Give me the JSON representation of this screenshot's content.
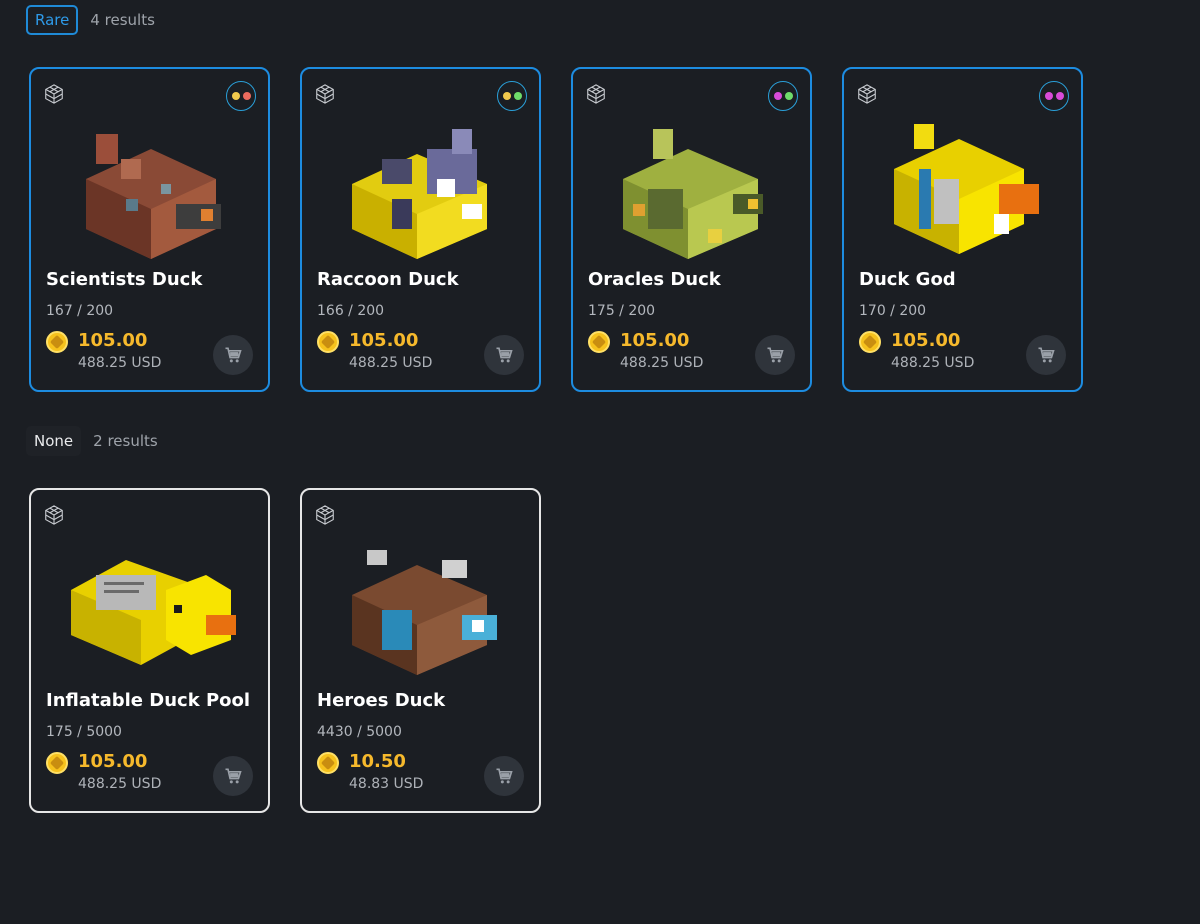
{
  "sections": [
    {
      "chip": "Rare",
      "results": "4 results",
      "cards": [
        {
          "name": "Scientists Duck",
          "supply": "167 / 200",
          "price": "105.00",
          "usd": "488.25 USD",
          "dot_colors": [
            "#f2c94c",
            "#eb6b5e"
          ]
        },
        {
          "name": "Raccoon Duck",
          "supply": "166 / 200",
          "price": "105.00",
          "usd": "488.25 USD",
          "dot_colors": [
            "#f2c94c",
            "#6fdc6a"
          ]
        },
        {
          "name": "Oracles Duck",
          "supply": "175 / 200",
          "price": "105.00",
          "usd": "488.25 USD",
          "dot_colors": [
            "#d94bd9",
            "#6fdc6a"
          ]
        },
        {
          "name": "Duck God",
          "supply": "170 / 200",
          "price": "105.00",
          "usd": "488.25 USD",
          "dot_colors": [
            "#d94bd9",
            "#d94bd9"
          ]
        }
      ]
    },
    {
      "chip": "None",
      "results": "2 results",
      "cards": [
        {
          "name": "Inflatable Duck Pool",
          "supply": "175 / 5000",
          "price": "105.00",
          "usd": "488.25 USD"
        },
        {
          "name": "Heroes Duck",
          "supply": "4430 / 5000",
          "price": "10.50",
          "usd": "48.83 USD"
        }
      ]
    }
  ],
  "icons": {
    "model": "cube-3d-icon",
    "currency": "coin-icon",
    "cart": "cart-icon",
    "traits": "trait-dots-icon"
  },
  "colors": {
    "background": "#1b1e23",
    "rare_border": "#1d8ce0",
    "none_border": "#e6e6e6",
    "price": "#f6b92c"
  }
}
